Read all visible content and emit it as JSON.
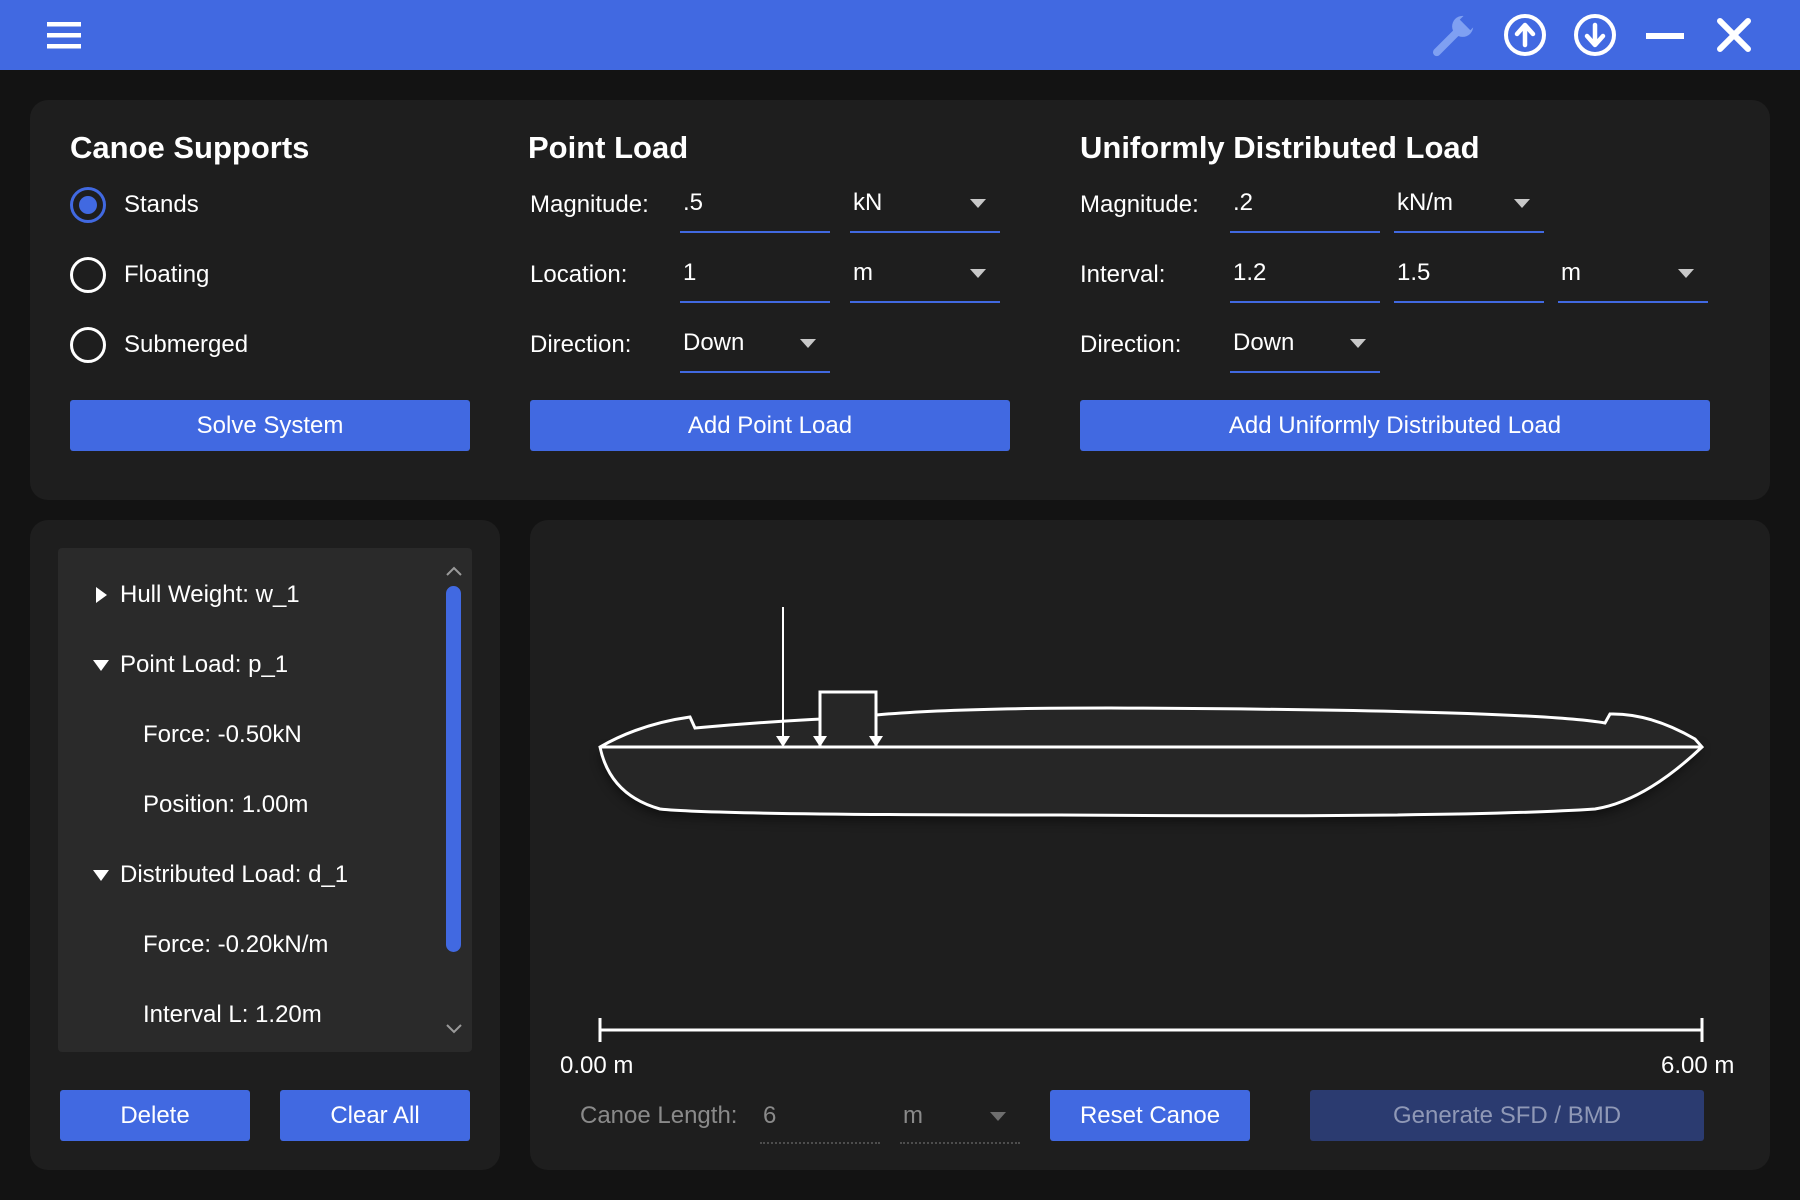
{
  "toolbar": {
    "icons": [
      "menu-icon",
      "wrench-icon",
      "upload-icon",
      "download-icon",
      "minimize-icon",
      "close-icon"
    ]
  },
  "supports": {
    "title": "Canoe Supports",
    "options": [
      "Stands",
      "Floating",
      "Submerged"
    ],
    "selected": "Stands",
    "solve_label": "Solve System"
  },
  "point_load": {
    "title": "Point Load",
    "magnitude_label": "Magnitude:",
    "magnitude_value": ".5",
    "magnitude_unit": "kN",
    "location_label": "Location:",
    "location_value": "1",
    "location_unit": "m",
    "direction_label": "Direction:",
    "direction_value": "Down",
    "add_label": "Add Point Load"
  },
  "udl": {
    "title": "Uniformly Distributed Load",
    "magnitude_label": "Magnitude:",
    "magnitude_value": ".2",
    "magnitude_unit": "kN/m",
    "interval_label": "Interval:",
    "interval_start": "1.2",
    "interval_end": "1.5",
    "interval_unit": "m",
    "direction_label": "Direction:",
    "direction_value": "Down",
    "add_label": "Add Uniformly Distributed Load"
  },
  "load_list": {
    "items": [
      {
        "text": "Hull Weight: w_1"
      },
      {
        "text": "Point Load: p_1"
      },
      {
        "text": "Force: -0.50kN"
      },
      {
        "text": "Position: 1.00m"
      },
      {
        "text": "Distributed Load: d_1"
      },
      {
        "text": "Force: -0.20kN/m"
      },
      {
        "text": "Interval L: 1.20m"
      }
    ],
    "delete_label": "Delete",
    "clear_label": "Clear All"
  },
  "canoe": {
    "scale_start": "0.00 m",
    "scale_end": "6.00 m",
    "length_label": "Canoe Length:",
    "length_value": "6",
    "length_unit": "m",
    "reset_label": "Reset Canoe",
    "generate_label": "Generate SFD / BMD"
  },
  "colors": {
    "accent": "#4169e1",
    "background": "#131313",
    "panel": "#1e1e1e",
    "list": "#2a2a2a"
  }
}
